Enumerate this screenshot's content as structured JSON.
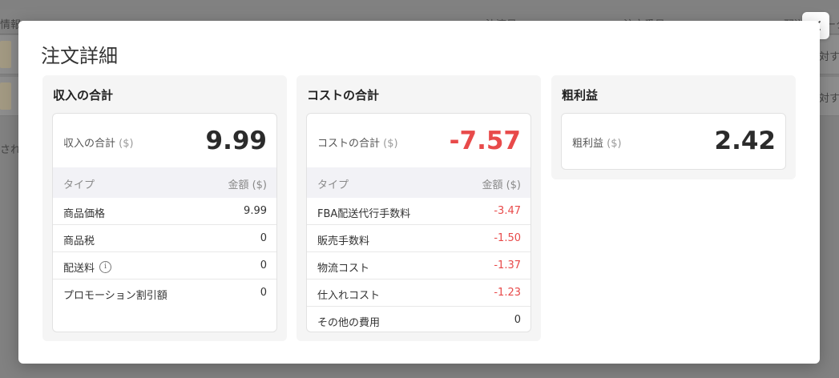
{
  "background": {
    "header_cols": [
      "情報",
      "決済日",
      "注文番号",
      "配送ステータス"
    ],
    "row_texts": [
      "対す",
      "対す"
    ],
    "side_text": "され"
  },
  "modal": {
    "title": "注文詳細",
    "close_label": "✕"
  },
  "revenue": {
    "title": "収入の合計",
    "summary_label": "収入の合計",
    "unit": "($)",
    "total": "9.99",
    "col_type": "タイプ",
    "col_amount": "金額 ($)",
    "rows": [
      {
        "label": "商品価格",
        "value": "9.99"
      },
      {
        "label": "商品税",
        "value": "0"
      },
      {
        "label": "配送料",
        "value": "0",
        "info_icon": "info-icon"
      },
      {
        "label": "プロモーション割引額",
        "value": "0"
      }
    ]
  },
  "cost": {
    "title": "コストの合計",
    "summary_label": "コストの合計",
    "unit": "($)",
    "total": "-7.57",
    "col_type": "タイプ",
    "col_amount": "金額 ($)",
    "rows": [
      {
        "label": "FBA配送代行手数料",
        "value": "-3.47"
      },
      {
        "label": "販売手数料",
        "value": "-1.50"
      },
      {
        "label": "物流コスト",
        "value": "-1.37"
      },
      {
        "label": "仕入れコスト",
        "value": "-1.23"
      },
      {
        "label": "その他の費用",
        "value": "0"
      }
    ]
  },
  "profit": {
    "title": "粗利益",
    "summary_label": "粗利益",
    "unit": "($)",
    "total": "2.42"
  },
  "colors": {
    "negative": "#e84a4a",
    "panel_bg": "#f5f5f5",
    "table_head_bg": "#f2f2f6"
  }
}
